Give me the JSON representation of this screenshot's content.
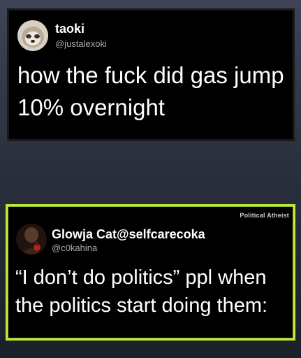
{
  "post_top": {
    "display_name": "taoki",
    "handle": "@justalexoki",
    "text": "how the fuck did gas jump 10% overnight",
    "avatar_icon": "avatar-sloth-icon"
  },
  "post_bottom": {
    "display_name": "Glowja Cat",
    "display_handle_inline": "@selfcarecoka",
    "handle": "@c0kahina",
    "text": "“I don’t do politics” ppl when the politics start doing them:",
    "watermark": "Political Atheist",
    "avatar_icon": "avatar-person-icon",
    "border_color": "#c8e63a"
  },
  "colors": {
    "background_top": "#3e4455",
    "background_bottom": "#1c2029",
    "card_bg": "#000000",
    "handle_text": "#a9a9a9"
  }
}
